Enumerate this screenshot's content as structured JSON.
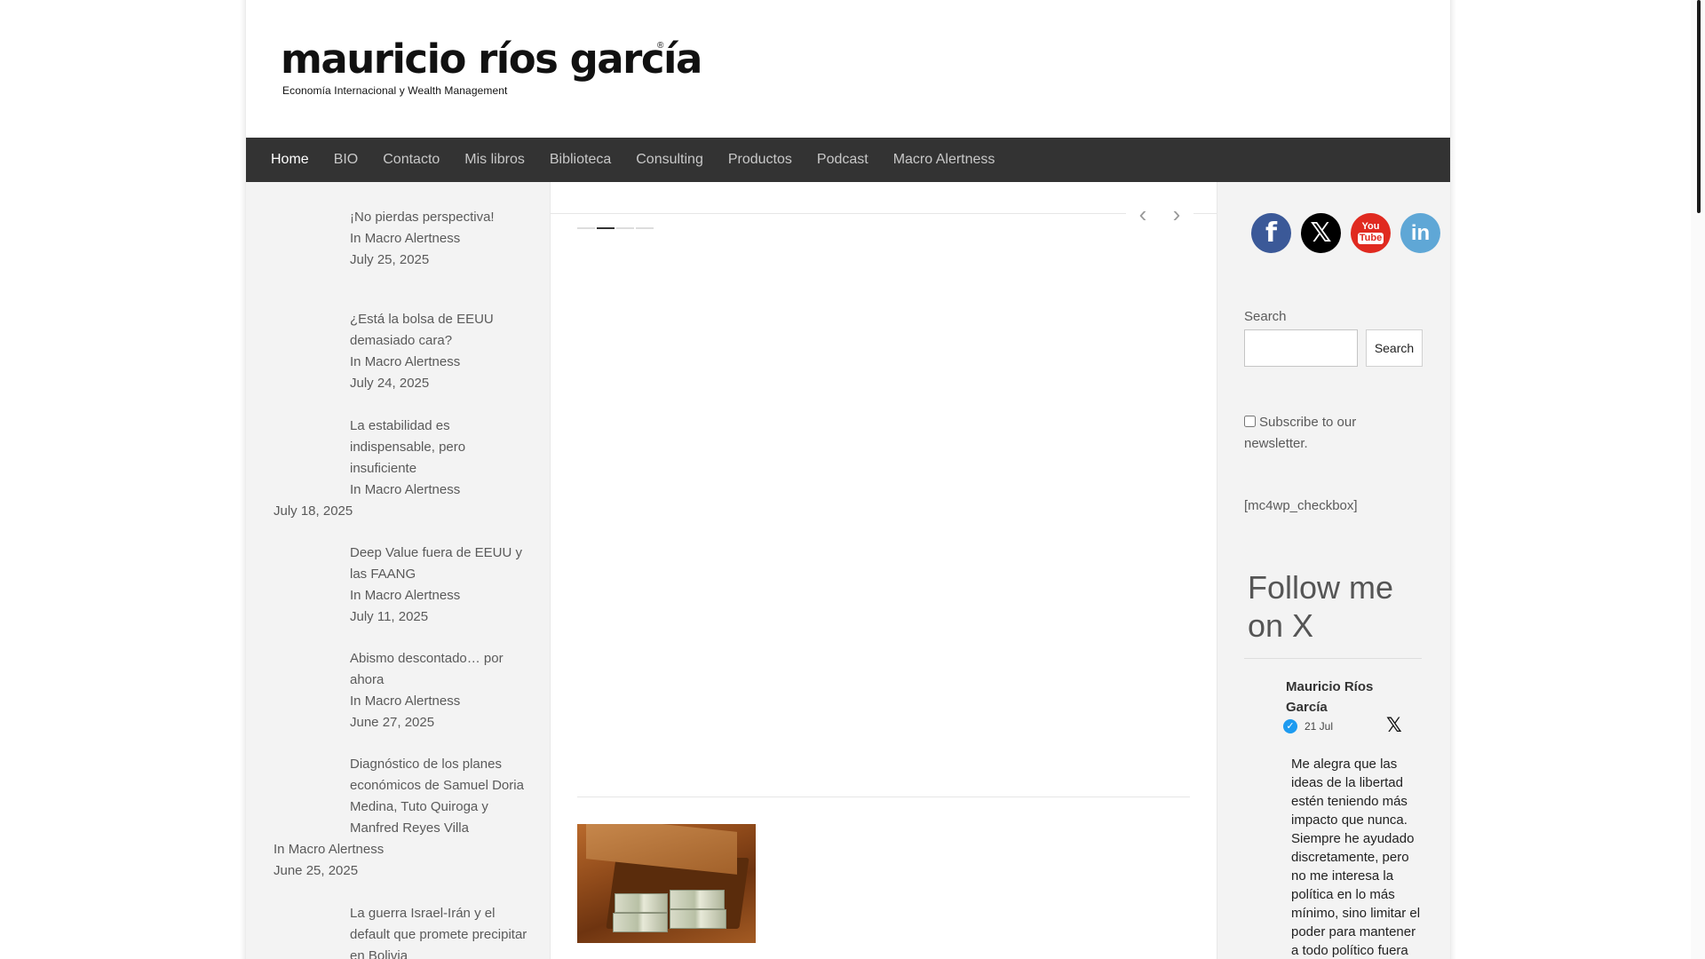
{
  "header": {
    "logo_title": "mauricio ríos garcía",
    "logo_reg": "®",
    "logo_subtitle": "Economía Internacional y Wealth Management"
  },
  "nav": {
    "items": [
      {
        "label": "Home",
        "active": true
      },
      {
        "label": "BIO"
      },
      {
        "label": "Contacto"
      },
      {
        "label": "Mis libros"
      },
      {
        "label": "Biblioteca"
      },
      {
        "label": "Consulting"
      },
      {
        "label": "Productos"
      },
      {
        "label": "Podcast"
      },
      {
        "label": "Macro Alertness"
      }
    ]
  },
  "recent_posts": [
    {
      "title": "¡No pierdas perspectiva!",
      "category_prefix": "In ",
      "category": "Macro Alertness",
      "date": "July 25, 2025"
    },
    {
      "title": "¿Está la bolsa de EEUU demasiado cara?",
      "category_prefix": "In ",
      "category": "Macro Alertness",
      "date": "July 24, 2025"
    },
    {
      "title": "La estabilidad es indispensable, pero insuficiente",
      "category_prefix": "In ",
      "category": "Macro Alertness",
      "date": "July 18, 2025"
    },
    {
      "title": "Deep Value fuera de EEUU y las FAANG",
      "category_prefix": "In ",
      "category": "Macro Alertness",
      "date": "July 11, 2025"
    },
    {
      "title": "Abismo descontado… por ahora",
      "category_prefix": "In ",
      "category": "Macro Alertness",
      "date": "June 27, 2025"
    },
    {
      "title": "Diagnóstico de los planes económicos de Samuel Doria Medina, Tuto Quiroga y Manfred Reyes Villa",
      "category_prefix": "In ",
      "category": "Macro Alertness",
      "date": "June 25, 2025"
    },
    {
      "title": "La guerra Israel-Irán y el default que promete precipitar en Bolivia",
      "category_prefix": "",
      "category": "",
      "date": ""
    }
  ],
  "slider": {
    "prev_icon": "‹",
    "next_icon": "›",
    "dots": 4,
    "active_dot": 1
  },
  "sidebar": {
    "social": [
      {
        "name": "facebook-icon",
        "glyph": "f"
      },
      {
        "name": "x-icon",
        "glyph": "𝕏"
      },
      {
        "name": "youtube-icon",
        "glyph_top": "You",
        "glyph_bottom": "Tube"
      },
      {
        "name": "linkedin-icon",
        "glyph": "in"
      }
    ],
    "search_label": "Search",
    "search_placeholder": "",
    "search_button": "Search",
    "newsletter_label": "Subscribe to our newsletter.",
    "shortcode": "[mc4wp_checkbox]",
    "follow_title": "Follow me on X",
    "tweet": {
      "author": "Mauricio Ríos García",
      "verified_glyph": "✓",
      "date": "21 Jul",
      "x_glyph": "𝕏",
      "text": "Me alegra que las ideas de la libertad estén teniendo más impacto que nunca. Siempre he ayudado discretamente, pero no me interesa la política en lo más mínimo, sino limitar el poder para mantener a todo político fuera"
    }
  },
  "colors": {
    "nav_bg": "#333333",
    "sidebar_bg": "#f3f3f3",
    "facebook": "#3b5998",
    "youtube": "#e02a20",
    "linkedin": "#5fa7d6",
    "verified": "#1d9bf0"
  }
}
